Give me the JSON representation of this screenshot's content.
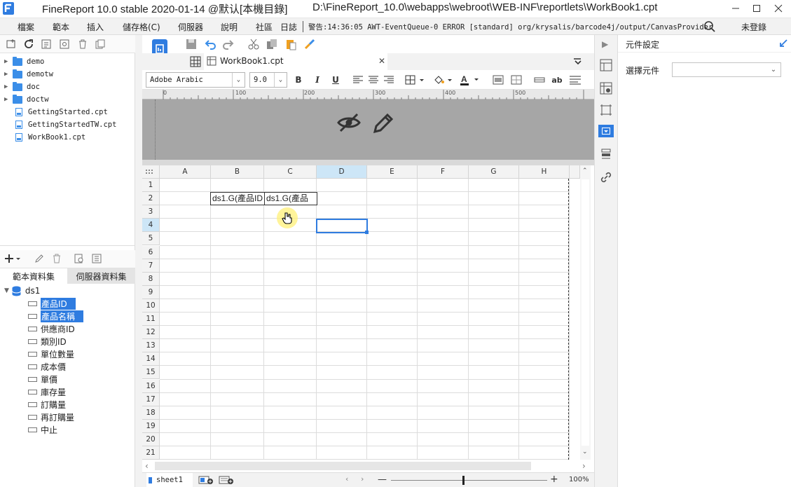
{
  "window": {
    "title": "FineReport 10.0 stable 2020-01-14 @默认[本機目錄]",
    "path": "D:\\FineReport_10.0\\webapps\\webroot\\WEB-INF\\reportlets\\WorkBook1.cpt"
  },
  "menu": {
    "items": [
      "檔案",
      "範本",
      "插入",
      "儲存格(C)",
      "伺服器",
      "說明",
      "社區",
      "日誌"
    ],
    "warning": "警告:14:36:05 AWT-EventQueue-0 ERROR [standard] org/krysalis/barcode4j/output/CanvasProvider",
    "login": "未登錄"
  },
  "files": {
    "folders": [
      "demo",
      "demotw",
      "doc",
      "doctw"
    ],
    "templates": [
      "GettingStarted.cpt",
      "GettingStartedTW.cpt",
      "WorkBook1.cpt"
    ]
  },
  "datasets": {
    "tab_template": "範本資料集",
    "tab_server": "伺服器資料集",
    "ds_name": "ds1",
    "columns": [
      "產品ID",
      "產品名稱",
      "供應商ID",
      "類別ID",
      "單位數量",
      "成本價",
      "單價",
      "庫存量",
      "訂購量",
      "再訂購量",
      "中止"
    ]
  },
  "editor": {
    "tab_label": "WorkBook1.cpt",
    "font_name": "Adobe Arabic",
    "font_size": "9.0",
    "ruler_labels": [
      "0",
      "100",
      "200",
      "300",
      "400",
      "500"
    ],
    "columns": [
      "A",
      "B",
      "C",
      "D",
      "E",
      "F",
      "G",
      "H"
    ],
    "rows": [
      "1",
      "2",
      "3",
      "4",
      "5",
      "6",
      "7",
      "8",
      "9",
      "10",
      "11",
      "12",
      "13",
      "14",
      "15",
      "16",
      "17",
      "18",
      "19",
      "20",
      "21"
    ],
    "cell_b2": "ds1.G(產品ID",
    "cell_c2": "ds1.G(產品",
    "sheet_name": "sheet1",
    "zoom": "100%",
    "selected_cell": "D4"
  },
  "widget_panel": {
    "title": "元件設定",
    "select_label": "選擇元件",
    "select_value": ""
  },
  "colors": {
    "accent": "#2f7ce0",
    "selected_header": "#cde6f7",
    "band": "#a6a6a6"
  }
}
